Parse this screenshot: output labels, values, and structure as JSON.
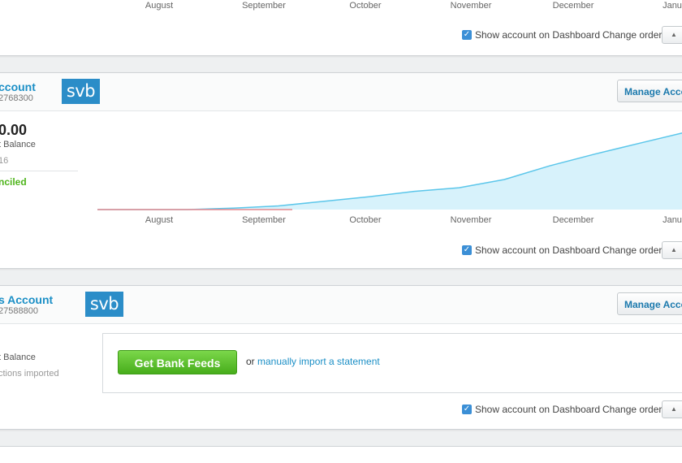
{
  "months": [
    "August",
    "September",
    "October",
    "November",
    "December",
    "Janu"
  ],
  "footer": {
    "show_on_dashboard": "Show account on Dashboard",
    "change_order": "Change order"
  },
  "account1": {
    "name": "ccount",
    "number": "2768300",
    "logo_text": "svb",
    "manage_label": "Manage Acco",
    "balance": "0.00",
    "balance_label": "t Balance",
    "date": "16",
    "status": "nciled",
    "chart_data": {
      "type": "area",
      "x_ticks": [
        "August",
        "September",
        "October",
        "November",
        "December",
        "Janu"
      ],
      "series": [
        {
          "values": [
            0,
            0,
            0,
            1.5,
            4,
            9,
            14,
            20,
            24,
            33,
            48,
            61,
            73,
            85
          ]
        }
      ],
      "fill_color": "#d7f2fb",
      "line_color": "#5bc6ea",
      "baseline_color": "#e7898f"
    }
  },
  "account2": {
    "name": "s Account",
    "number": "27588800",
    "logo_text": "svb",
    "manage_label": "Manage Acco",
    "balance_label": "t Balance",
    "transactions_label": "ctions imported",
    "feeds_button": "Get Bank Feeds",
    "or_text": "or",
    "import_link": "manually import a statement"
  }
}
